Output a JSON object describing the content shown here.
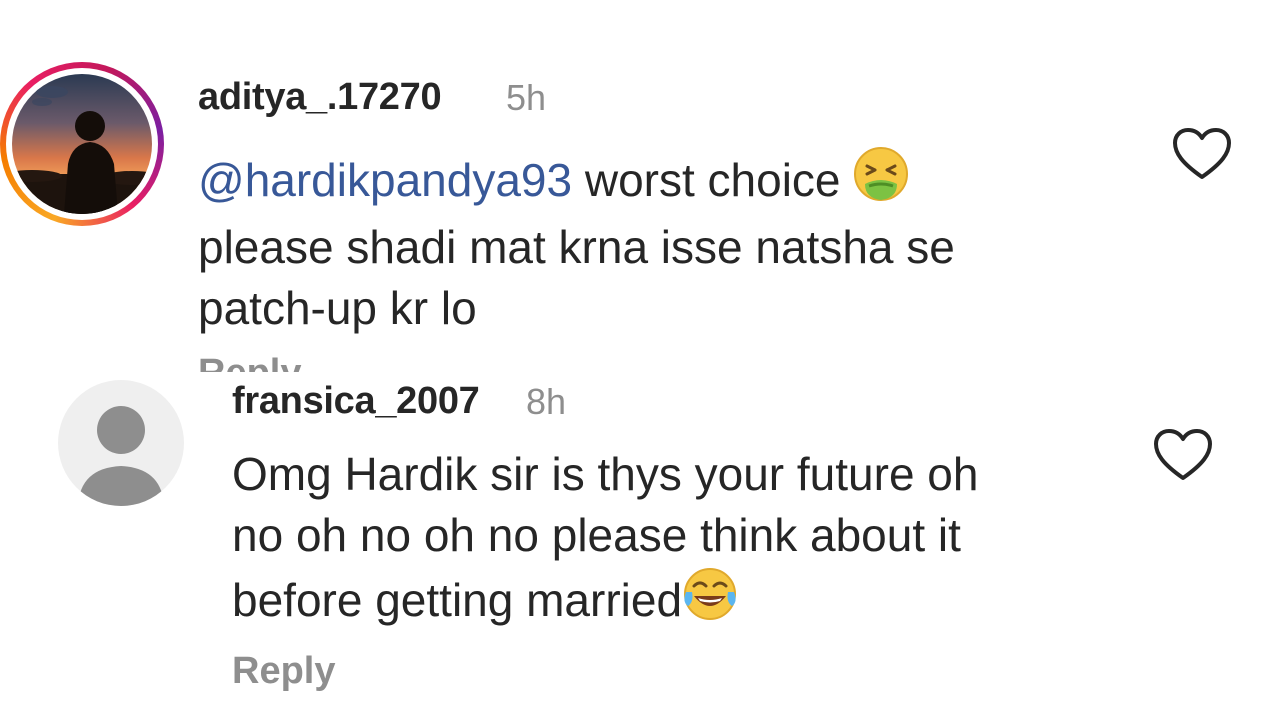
{
  "comments": [
    {
      "username": "aditya_.17270",
      "time": "5h",
      "mention": "@hardikpandya93",
      "line1_rest": " worst choice ",
      "line1_emoji_icon": "nauseated-face-emoji",
      "line2": "please shadi mat krna isse natsha se",
      "line3": "patch-up kr lo",
      "reply_label": "Reply",
      "avatar_icon": "sunset-silhouette-photo",
      "has_story_ring": true
    },
    {
      "username": "fransica_2007",
      "time": "8h",
      "line1": "Omg Hardik sir is thys your future oh",
      "line2": "no oh no oh no please think about it",
      "line3": "before getting married",
      "line3_emoji_icon": "face-with-tears-of-joy-emoji",
      "reply_label": "Reply",
      "avatar_icon": "default-user-avatar"
    }
  ],
  "colors": {
    "mention": "#385898",
    "username": "#262626",
    "meta": "#8e8e8e",
    "body": "#262626"
  }
}
